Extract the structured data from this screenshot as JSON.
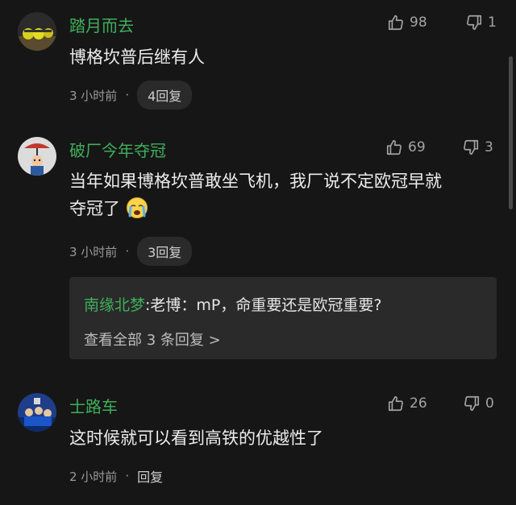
{
  "comments": [
    {
      "username": "踏月而去",
      "text": "博格坎普后继有人",
      "time": "3 小时前",
      "likes": "98",
      "dislikes": "1",
      "reply_label": "4回复"
    },
    {
      "username": "破厂今年夺冠",
      "text_line1": "当年如果博格坎普敢坐飞机，我厂说不定欧冠早就",
      "text_line2": "夺冠了",
      "time": "3 小时前",
      "likes": "69",
      "dislikes": "3",
      "reply_label": "3回复",
      "sub_reply": {
        "username": "南缘北梦",
        "separator": ":",
        "text": "老博：mP，命重要还是欧冠重要?",
        "view_all": "查看全部 3 条回复 >"
      }
    },
    {
      "username": "士路车",
      "text": "这时候就可以看到高铁的优越性了",
      "time": "2 小时前",
      "likes": "26",
      "dislikes": "0",
      "reply_label": "回复"
    }
  ],
  "colors": {
    "background": "#161616",
    "username": "#3fae5a",
    "pill": "#2a2a2a"
  },
  "icons": [
    "thumbs-up-icon",
    "thumbs-down-icon",
    "crying-emoji-icon"
  ]
}
